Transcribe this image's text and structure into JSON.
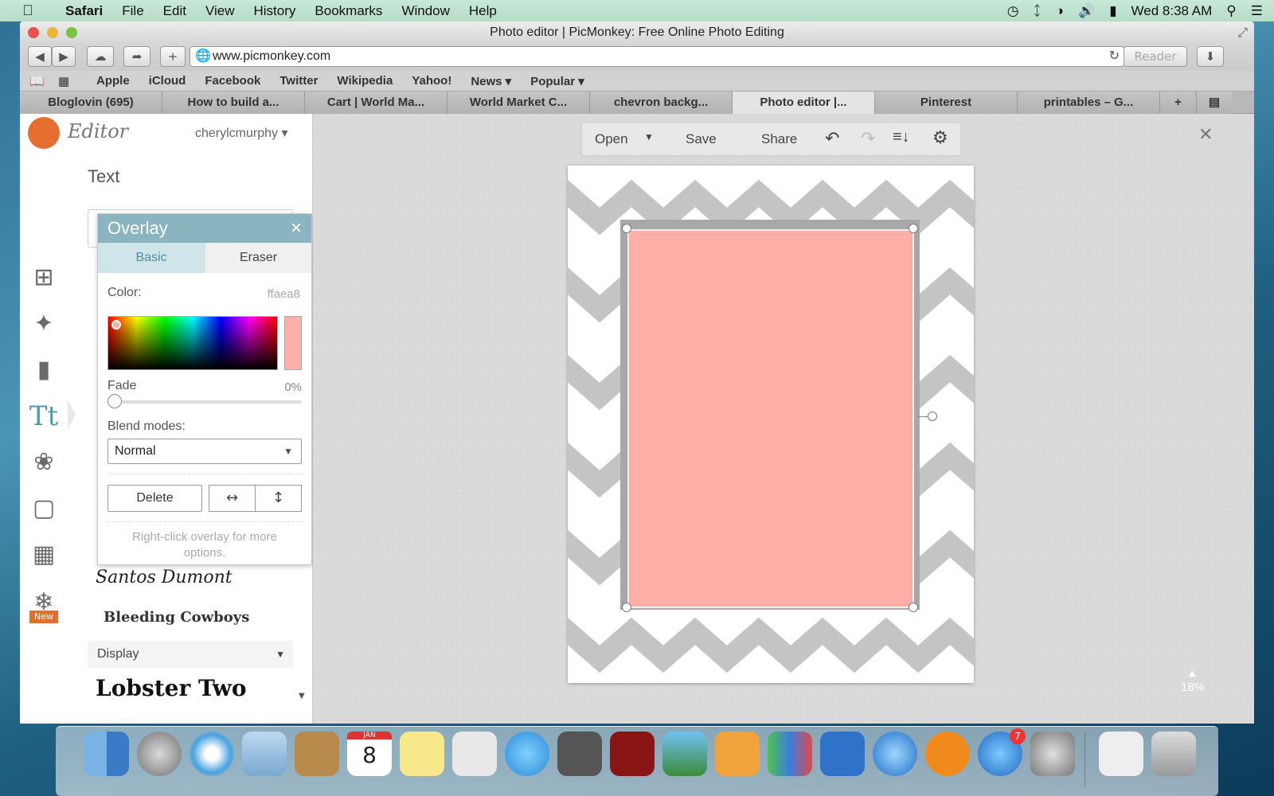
{
  "menubar": {
    "apple_icon": "apple-logo",
    "app": "Safari",
    "items": [
      "File",
      "Edit",
      "View",
      "History",
      "Bookmarks",
      "Window",
      "Help"
    ],
    "clock": "Wed 8:38 AM"
  },
  "window": {
    "title": "Photo editor | PicMonkey: Free Online Photo Editing"
  },
  "toolbar": {
    "url": "www.picmonkey.com",
    "reader": "Reader"
  },
  "favorites": [
    "Apple",
    "iCloud",
    "Facebook",
    "Twitter",
    "Wikipedia",
    "Yahoo!",
    "News ▾",
    "Popular ▾"
  ],
  "tabs": [
    "Bloglovin (695)",
    "How to build a...",
    "Cart | World Ma...",
    "World Market C...",
    "chevron backg...",
    "Photo editor |...",
    "Pinterest",
    "printables – G..."
  ],
  "editor": {
    "logo": "Editor",
    "user": "cherylcmurphy",
    "section": "Text",
    "fonts": [
      "Santos Dumont",
      "Bleeding Cowboys",
      "Lobster Two"
    ],
    "category": "Display",
    "new_badge": "New"
  },
  "overlay": {
    "title": "Overlay",
    "close": "×",
    "tab_basic": "Basic",
    "tab_eraser": "Eraser",
    "color_label": "Color:",
    "color_value": "ffaea8",
    "fade_label": "Fade",
    "fade_value": "0%",
    "fade_fraction": 0,
    "blend_label": "Blend modes:",
    "blend_value": "Normal",
    "delete": "Delete",
    "hint": "Right-click overlay for more options."
  },
  "picmenu": {
    "open": "Open",
    "save": "Save",
    "share": "Share"
  },
  "zoom": "18%",
  "dock": {
    "calendar_month": "JAN",
    "calendar_day": "8",
    "appstore_badge": "7"
  },
  "colors": {
    "overlay_fill": "#ffaea8",
    "accent": "#8ab4bf",
    "chevron": "#c4c4c4"
  }
}
